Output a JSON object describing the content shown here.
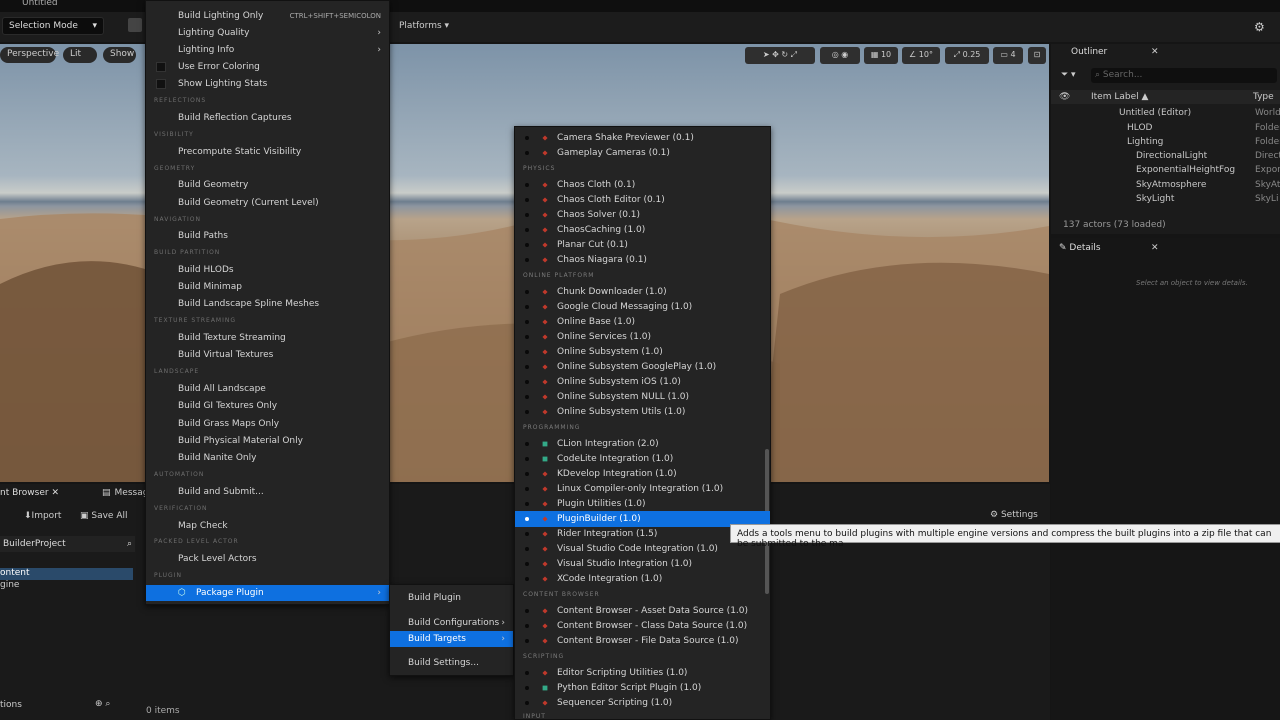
{
  "window": {
    "title": "Untitled"
  },
  "toolbar": {
    "selection_mode": "Selection Mode",
    "platforms": "Platforms"
  },
  "viewport": {
    "perspective": "Perspective",
    "lit": "Lit",
    "show": "Show",
    "grid": "10",
    "angle": "10°",
    "scale": "0.25",
    "camera": "4",
    "settings": "Settings"
  },
  "outliner": {
    "tab": "Outliner",
    "search": "Search...",
    "col_label": "Item Label",
    "col_type": "Type",
    "rows": [
      {
        "label": "Untitled (Editor)",
        "type": "World"
      },
      {
        "label": "HLOD",
        "type": "Folder"
      },
      {
        "label": "Lighting",
        "type": "Folder"
      },
      {
        "label": "DirectionalLight",
        "type": "Direct"
      },
      {
        "label": "ExponentialHeightFog",
        "type": "Expon"
      },
      {
        "label": "SkyAtmosphere",
        "type": "SkyAt"
      },
      {
        "label": "SkyLight",
        "type": "SkyLi"
      }
    ],
    "status": "137 actors (73 loaded)"
  },
  "details": {
    "tab": "Details",
    "empty": "Select an object to view details."
  },
  "content": {
    "tab1": "nt Browser",
    "tab2": "Message Log",
    "import": "Import",
    "save_all": "Save All",
    "project": "BuilderProject",
    "tree1": "ontent",
    "tree2": "gine",
    "items": "0 items",
    "collections": "tions"
  },
  "build_menu": {
    "items": [
      {
        "label": "Build Lighting Only",
        "shortcut": "CTRL+SHIFT+SEMICOLON"
      },
      {
        "label": "Lighting Quality"
      },
      {
        "label": "Lighting Info"
      },
      {
        "label": "Use Error Coloring"
      },
      {
        "label": "Show Lighting Stats"
      },
      {
        "label": "Build Reflection Captures"
      },
      {
        "label": "Precompute Static Visibility"
      },
      {
        "label": "Build Geometry"
      },
      {
        "label": "Build Geometry (Current Level)"
      },
      {
        "label": "Build Paths"
      },
      {
        "label": "Build HLODs"
      },
      {
        "label": "Build Minimap"
      },
      {
        "label": "Build Landscape Spline Meshes"
      },
      {
        "label": "Build Texture Streaming"
      },
      {
        "label": "Build Virtual Textures"
      },
      {
        "label": "Build All Landscape"
      },
      {
        "label": "Build GI Textures Only"
      },
      {
        "label": "Build Grass Maps Only"
      },
      {
        "label": "Build Physical Material Only"
      },
      {
        "label": "Build Nanite Only"
      },
      {
        "label": "Build and Submit..."
      },
      {
        "label": "Map Check"
      },
      {
        "label": "Pack Level Actors"
      },
      {
        "label": "Package Plugin"
      }
    ],
    "sections": [
      "REFLECTIONS",
      "VISIBILITY",
      "GEOMETRY",
      "NAVIGATION",
      "BUILD PARTITION",
      "TEXTURE STREAMING",
      "LANDSCAPE",
      "AUTOMATION",
      "VERIFICATION",
      "PACKED LEVEL ACTOR",
      "PLUGIN"
    ]
  },
  "package_menu": {
    "items": [
      "Build Plugin",
      "Build Configurations",
      "Build Targets",
      "Build Settings..."
    ]
  },
  "plugin_menu": {
    "sections": [
      "PHYSICS",
      "ONLINE PLATFORM",
      "PROGRAMMING",
      "CONTENT BROWSER",
      "SCRIPTING",
      "INPUT"
    ],
    "items": [
      "Camera Shake Previewer (0.1)",
      "Gameplay Cameras (0.1)",
      "Chaos Cloth (0.1)",
      "Chaos Cloth Editor (0.1)",
      "Chaos Solver (0.1)",
      "ChaosCaching (1.0)",
      "Planar Cut (0.1)",
      "Chaos Niagara (0.1)",
      "Chunk Downloader (1.0)",
      "Google Cloud Messaging (1.0)",
      "Online Base (1.0)",
      "Online Services (1.0)",
      "Online Subsystem (1.0)",
      "Online Subsystem GooglePlay (1.0)",
      "Online Subsystem iOS (1.0)",
      "Online Subsystem NULL (1.0)",
      "Online Subsystem Utils (1.0)",
      "CLion Integration (2.0)",
      "CodeLite Integration (1.0)",
      "KDevelop Integration (1.0)",
      "Linux Compiler-only Integration (1.0)",
      "Plugin Utilities (1.0)",
      "PluginBuilder (1.0)",
      "Rider Integration (1.5)",
      "Visual Studio Code Integration (1.0)",
      "Visual Studio Integration (1.0)",
      "XCode Integration (1.0)",
      "Content Browser - Asset Data Source (1.0)",
      "Content Browser - Class Data Source (1.0)",
      "Content Browser - File Data Source (1.0)",
      "Editor Scripting Utilities (1.0)",
      "Python Editor Script Plugin (1.0)",
      "Sequencer Scripting (1.0)"
    ]
  },
  "tooltip": "Adds a tools menu to build plugins with multiple engine versions and compress the built plugins into a zip file that can be submitted to the ma"
}
